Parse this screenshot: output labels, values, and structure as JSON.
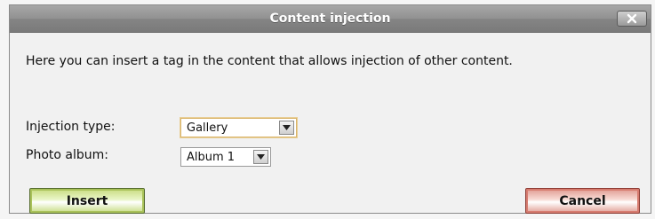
{
  "dialog": {
    "title": "Content injection",
    "description": "Here you can insert a tag in the content that allows injection of other content.",
    "fields": {
      "injection_type": {
        "label": "Injection type:",
        "value": "Gallery"
      },
      "photo_album": {
        "label": "Photo album:",
        "value": "Album 1"
      }
    },
    "buttons": {
      "insert": "Insert",
      "cancel": "Cancel"
    },
    "icons": {
      "close": "close-icon",
      "dropdown": "chevron-down-icon"
    }
  }
}
